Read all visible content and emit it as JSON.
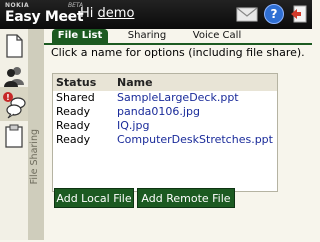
{
  "header": {
    "brand_small": "NOKIA",
    "brand_beta": "BETA",
    "brand_name": "Easy Meet",
    "greeting": "Hi",
    "username": "demo",
    "icons": [
      "mail-icon",
      "help-icon",
      "exit-icon"
    ]
  },
  "left_rail": {
    "items": [
      {
        "icon": "document-icon"
      },
      {
        "icon": "contacts-icon"
      },
      {
        "icon": "chat-icon",
        "badge": "!"
      },
      {
        "icon": "clipboard-icon"
      }
    ],
    "vertical_tab_label": "File Sharing"
  },
  "tabs": [
    {
      "label": "File List",
      "active": true
    },
    {
      "label": "Sharing",
      "active": false
    },
    {
      "label": "Voice Call",
      "active": false
    }
  ],
  "instruction": "Click a name for options (including file share).",
  "table": {
    "columns": [
      "Status",
      "Name"
    ],
    "rows": [
      {
        "status": "Shared",
        "name": "SampleLargeDeck.ppt"
      },
      {
        "status": "Ready",
        "name": "panda0106.jpg"
      },
      {
        "status": "Ready",
        "name": "IQ.jpg"
      },
      {
        "status": "Ready",
        "name": "ComputerDeskStretches.ppt"
      }
    ]
  },
  "buttons": {
    "add_local": "Add Local File",
    "add_remote": "Add Remote File"
  },
  "colors": {
    "accent": "#1c5a21",
    "link": "#1a2b9a",
    "header": "#111111"
  }
}
